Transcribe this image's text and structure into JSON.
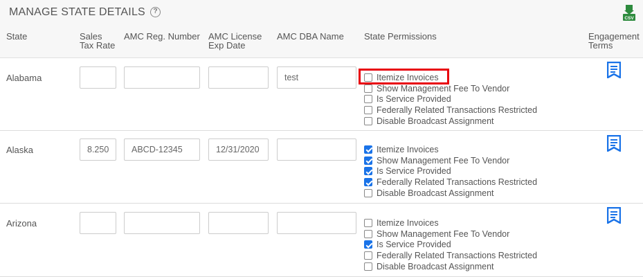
{
  "header": {
    "title": "MANAGE STATE DETAILS",
    "help_icon": "help-circle-icon",
    "csv_icon": "csv-export-icon",
    "csv_label": "CSV"
  },
  "columns": {
    "state": "State",
    "sales_tax_1": "Sales",
    "sales_tax_2": "Tax Rate",
    "amc_reg": "AMC Reg. Number",
    "amc_license_1": "AMC License",
    "amc_license_2": "Exp Date",
    "amc_dba": "AMC DBA Name",
    "permissions": "State Permissions",
    "engagement_1": "Engagement",
    "engagement_2": "Terms"
  },
  "rows": [
    {
      "state": "Alabama",
      "sales_tax": "",
      "amc_reg": "",
      "amc_license": "",
      "amc_dba": "test",
      "permissions": [
        {
          "label": "Itemize Invoices",
          "checked": false
        },
        {
          "label": "Show Management Fee To Vendor",
          "checked": false
        },
        {
          "label": "Is Service Provided",
          "checked": false
        },
        {
          "label": "Federally Related Transactions Restricted",
          "checked": false
        },
        {
          "label": "Disable Broadcast Assignment",
          "checked": false
        }
      ]
    },
    {
      "state": "Alaska",
      "sales_tax": "8.250",
      "amc_reg": "ABCD-12345",
      "amc_license": "12/31/2020",
      "amc_dba": "",
      "permissions": [
        {
          "label": "Itemize Invoices",
          "checked": true
        },
        {
          "label": "Show Management Fee To Vendor",
          "checked": true
        },
        {
          "label": "Is Service Provided",
          "checked": true
        },
        {
          "label": "Federally Related Transactions Restricted",
          "checked": true
        },
        {
          "label": "Disable Broadcast Assignment",
          "checked": false
        }
      ]
    },
    {
      "state": "Arizona",
      "sales_tax": "",
      "amc_reg": "",
      "amc_license": "",
      "amc_dba": "",
      "permissions": [
        {
          "label": "Itemize Invoices",
          "checked": false
        },
        {
          "label": "Show Management Fee To Vendor",
          "checked": false
        },
        {
          "label": "Is Service Provided",
          "checked": true
        },
        {
          "label": "Federally Related Transactions Restricted",
          "checked": false
        },
        {
          "label": "Disable Broadcast Assignment",
          "checked": false
        }
      ]
    }
  ],
  "engagement_icon": "document-icon",
  "colors": {
    "accent": "#1a73e8",
    "highlight": "#e8000b",
    "csv_green": "#2e8b3e"
  }
}
